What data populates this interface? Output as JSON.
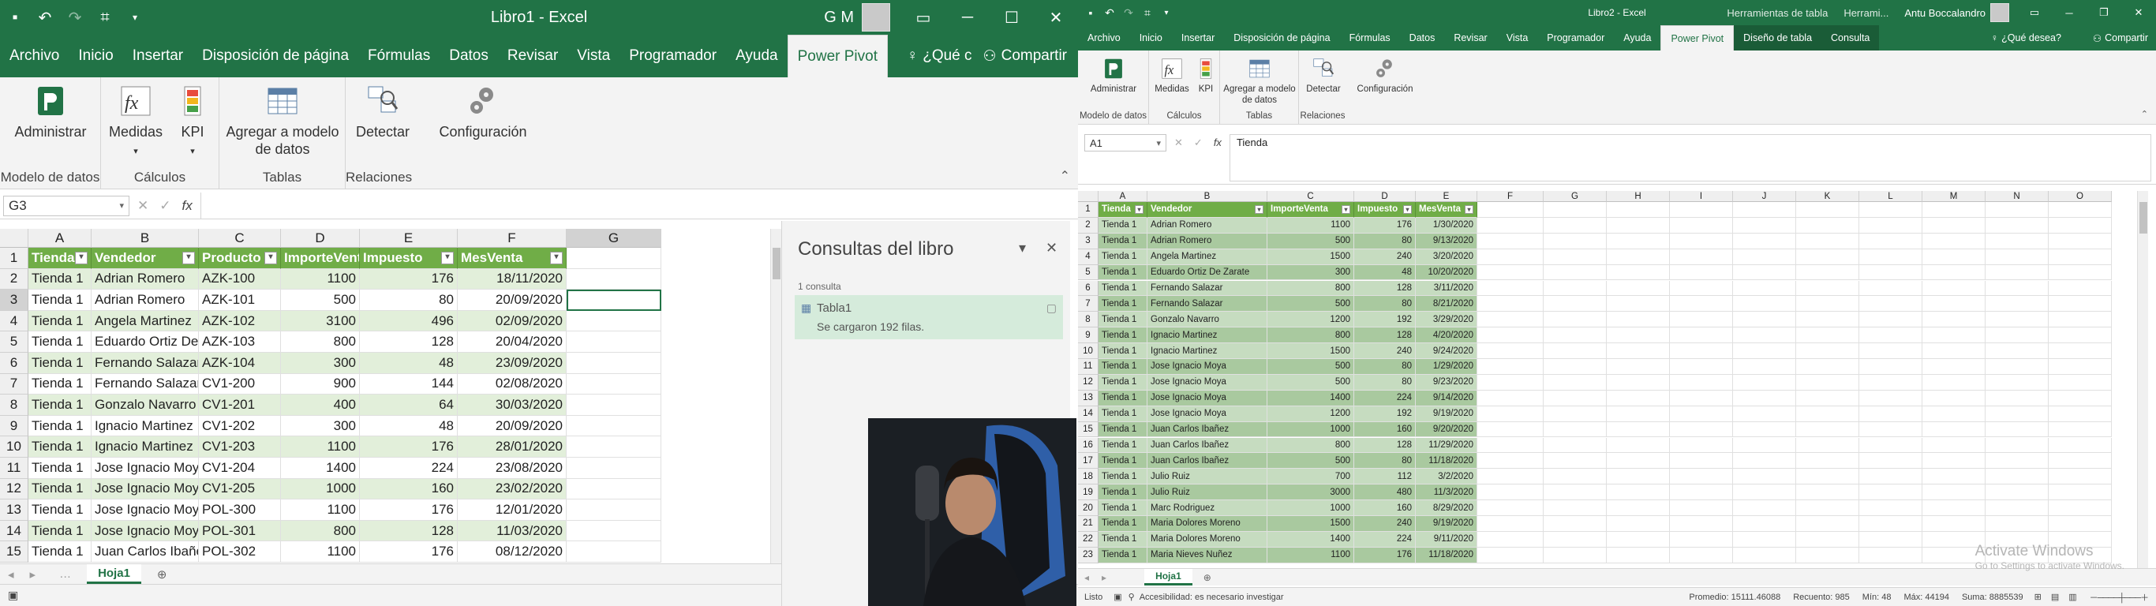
{
  "left": {
    "title": "Libro1  -  Excel",
    "user_initials": "G M",
    "tabs": [
      "Archivo",
      "Inicio",
      "Insertar",
      "Disposición de página",
      "Fórmulas",
      "Datos",
      "Revisar",
      "Vista",
      "Programador",
      "Ayuda",
      "Power Pivot"
    ],
    "active_tab": "Power Pivot",
    "tell_me": "¿Qué c",
    "share": "Compartir",
    "ribbon": {
      "g1_label": "Modelo de datos",
      "b_admin": "Administrar",
      "g2_label": "Cálculos",
      "b_medidas": "Medidas",
      "b_kpi": "KPI",
      "g3_label": "Tablas",
      "b_agregar": "Agregar a modelo de datos",
      "g4_label": "Relaciones",
      "b_detectar": "Detectar",
      "b_config": "Configuración"
    },
    "namebox": "G3",
    "columns": [
      "A",
      "B",
      "C",
      "D",
      "E",
      "F",
      "G"
    ],
    "headers": [
      "Tienda",
      "Vendedor",
      "Producto",
      "ImporteVenta",
      "Impuesto",
      "MesVenta"
    ],
    "rows": [
      [
        "Tienda 1",
        "Adrian Romero",
        "AZK-100",
        "1100",
        "176",
        "18/11/2020"
      ],
      [
        "Tienda 1",
        "Adrian Romero",
        "AZK-101",
        "500",
        "80",
        "20/09/2020"
      ],
      [
        "Tienda 1",
        "Angela Martinez",
        "AZK-102",
        "3100",
        "496",
        "02/09/2020"
      ],
      [
        "Tienda 1",
        "Eduardo Ortiz De Zarate",
        "AZK-103",
        "800",
        "128",
        "20/04/2020"
      ],
      [
        "Tienda 1",
        "Fernando Salazar",
        "AZK-104",
        "300",
        "48",
        "23/09/2020"
      ],
      [
        "Tienda 1",
        "Fernando Salazar",
        "CV1-200",
        "900",
        "144",
        "02/08/2020"
      ],
      [
        "Tienda 1",
        "Gonzalo Navarro",
        "CV1-201",
        "400",
        "64",
        "30/03/2020"
      ],
      [
        "Tienda 1",
        "Ignacio Martinez",
        "CV1-202",
        "300",
        "48",
        "20/09/2020"
      ],
      [
        "Tienda 1",
        "Ignacio Martinez",
        "CV1-203",
        "1100",
        "176",
        "28/01/2020"
      ],
      [
        "Tienda 1",
        "Jose Ignacio Moya",
        "CV1-204",
        "1400",
        "224",
        "23/08/2020"
      ],
      [
        "Tienda 1",
        "Jose Ignacio Moya",
        "CV1-205",
        "1000",
        "160",
        "23/02/2020"
      ],
      [
        "Tienda 1",
        "Jose Ignacio Moya",
        "POL-300",
        "1100",
        "176",
        "12/01/2020"
      ],
      [
        "Tienda 1",
        "Jose Ignacio Moya",
        "POL-301",
        "800",
        "128",
        "11/03/2020"
      ],
      [
        "Tienda 1",
        "Juan Carlos Ibañez",
        "POL-302",
        "1100",
        "176",
        "08/12/2020"
      ]
    ],
    "sheet_tab": "Hoja1",
    "queries": {
      "title": "Consultas del libro",
      "count": "1 consulta",
      "item_name": "Tabla1",
      "item_status": "Se cargaron 192 filas."
    }
  },
  "right": {
    "title": "Libro2  -  Excel",
    "ctx1": "Herramientas de tabla",
    "ctx2": "Herrami...",
    "user": "Antu Boccalandro",
    "tabs": [
      "Archivo",
      "Inicio",
      "Insertar",
      "Disposición de página",
      "Fórmulas",
      "Datos",
      "Revisar",
      "Vista",
      "Programador",
      "Ayuda",
      "Power Pivot",
      "Diseño de tabla",
      "Consulta"
    ],
    "active_tab": "Power Pivot",
    "tell_me": "¿Qué desea?",
    "share": "Compartir",
    "ribbon": {
      "g1_label": "Modelo de datos",
      "b_admin": "Administrar",
      "g2_label": "Cálculos",
      "b_medidas": "Medidas",
      "b_kpi": "KPI",
      "g3_label": "Tablas",
      "b_agregar": "Agregar a modelo de datos",
      "g4_label": "Relaciones",
      "b_detectar": "Detectar",
      "b_config": "Configuración"
    },
    "namebox": "A1",
    "formula": "Tienda",
    "columns": [
      "A",
      "B",
      "C",
      "D",
      "E",
      "F",
      "G",
      "H",
      "I",
      "J",
      "K",
      "L",
      "M",
      "N",
      "O"
    ],
    "headers": [
      "Tienda",
      "Vendedor",
      "ImporteVenta",
      "Impuesto",
      "MesVenta"
    ],
    "rows": [
      [
        "Tienda 1",
        "Adrian Romero",
        "1100",
        "176",
        "1/30/2020"
      ],
      [
        "Tienda 1",
        "Adrian Romero",
        "500",
        "80",
        "9/13/2020"
      ],
      [
        "Tienda 1",
        "Angela Martinez",
        "1500",
        "240",
        "3/20/2020"
      ],
      [
        "Tienda 1",
        "Eduardo Ortiz De Zarate",
        "300",
        "48",
        "10/20/2020"
      ],
      [
        "Tienda 1",
        "Fernando Salazar",
        "800",
        "128",
        "3/11/2020"
      ],
      [
        "Tienda 1",
        "Fernando Salazar",
        "500",
        "80",
        "8/21/2020"
      ],
      [
        "Tienda 1",
        "Gonzalo Navarro",
        "1200",
        "192",
        "3/29/2020"
      ],
      [
        "Tienda 1",
        "Ignacio Martinez",
        "800",
        "128",
        "4/20/2020"
      ],
      [
        "Tienda 1",
        "Ignacio Martinez",
        "1500",
        "240",
        "9/24/2020"
      ],
      [
        "Tienda 1",
        "Jose Ignacio Moya",
        "500",
        "80",
        "1/29/2020"
      ],
      [
        "Tienda 1",
        "Jose Ignacio Moya",
        "500",
        "80",
        "9/23/2020"
      ],
      [
        "Tienda 1",
        "Jose Ignacio Moya",
        "1400",
        "224",
        "9/14/2020"
      ],
      [
        "Tienda 1",
        "Jose Ignacio Moya",
        "1200",
        "192",
        "9/19/2020"
      ],
      [
        "Tienda 1",
        "Juan Carlos Ibañez",
        "1000",
        "160",
        "9/20/2020"
      ],
      [
        "Tienda 1",
        "Juan Carlos Ibañez",
        "800",
        "128",
        "11/29/2020"
      ],
      [
        "Tienda 1",
        "Juan Carlos Ibañez",
        "500",
        "80",
        "11/18/2020"
      ],
      [
        "Tienda 1",
        "Julio Ruiz",
        "700",
        "112",
        "3/2/2020"
      ],
      [
        "Tienda 1",
        "Julio Ruiz",
        "3000",
        "480",
        "11/3/2020"
      ],
      [
        "Tienda 1",
        "Marc Rodriguez",
        "1000",
        "160",
        "8/29/2020"
      ],
      [
        "Tienda 1",
        "Maria Dolores Moreno",
        "1500",
        "240",
        "9/19/2020"
      ],
      [
        "Tienda 1",
        "Maria Dolores Moreno",
        "1400",
        "224",
        "9/11/2020"
      ],
      [
        "Tienda 1",
        "Maria Nieves Nuñez",
        "1100",
        "176",
        "11/18/2020"
      ]
    ],
    "sheet_tab": "Hoja1",
    "status": {
      "ready": "Listo",
      "accessibility": "Accesibilidad: es necesario investigar",
      "promedio": "Promedio: 15111.46088",
      "recuento": "Recuento: 985",
      "min": "Mín: 48",
      "max": "Máx: 44194",
      "suma": "Suma: 8885539"
    },
    "watermark1": "Activate Windows",
    "watermark2": "Go to Settings to activate Windows."
  }
}
